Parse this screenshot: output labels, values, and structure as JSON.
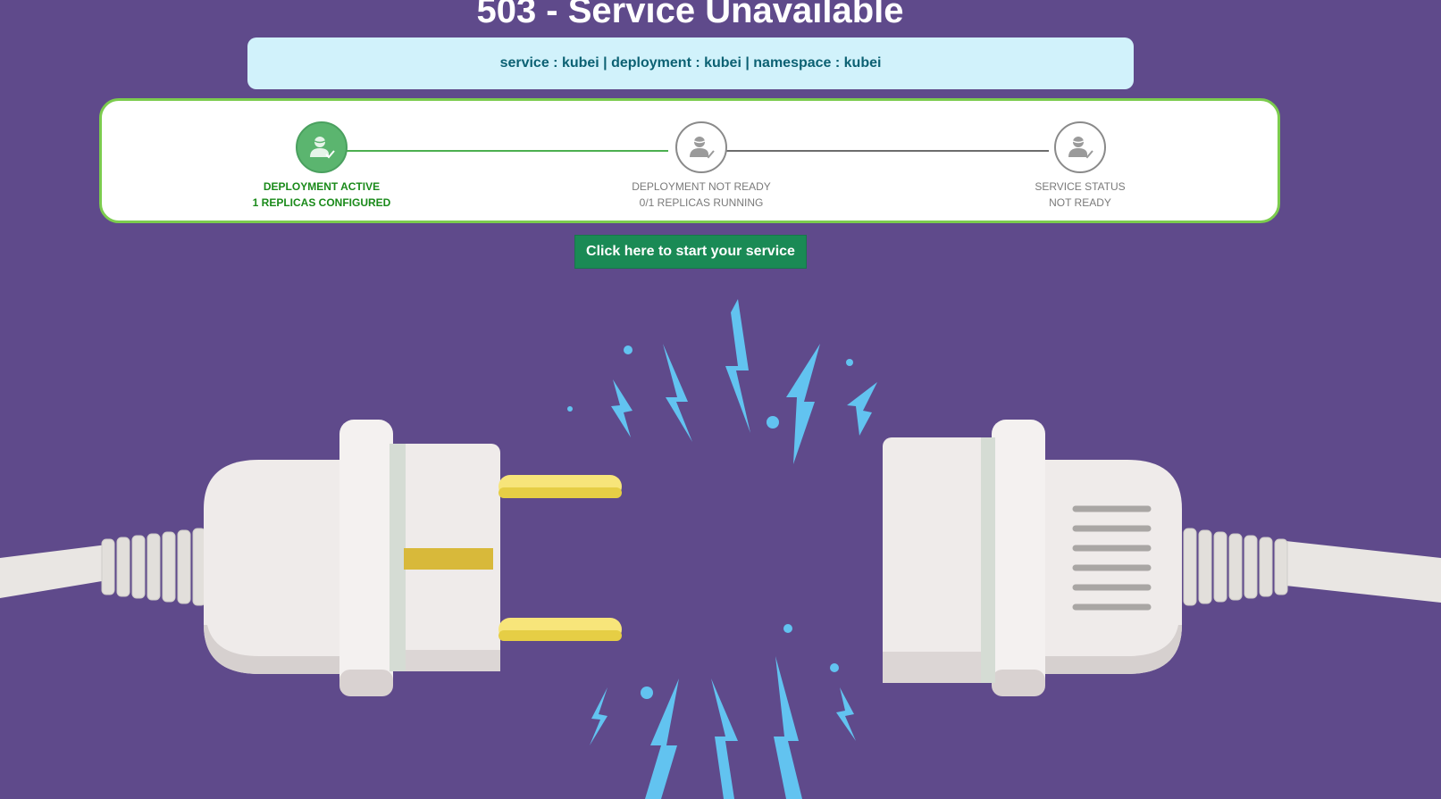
{
  "page": {
    "title": "503 - Service Unavailable"
  },
  "info_banner": {
    "text": "service : kubei | deployment : kubei | namespace : kubei"
  },
  "status_steps": [
    {
      "line1": "DEPLOYMENT ACTIVE",
      "line2": "1 REPLICAS CONFIGURED",
      "state": "active",
      "icon": "user-check-icon"
    },
    {
      "line1": "DEPLOYMENT NOT READY",
      "line2": "0/1 REPLICAS RUNNING",
      "state": "inactive",
      "icon": "user-check-icon"
    },
    {
      "line1": "SERVICE STATUS",
      "line2": "NOT READY",
      "state": "inactive",
      "icon": "user-check-icon"
    }
  ],
  "actions": {
    "start_label": "Click here to start your service"
  },
  "colors": {
    "background": "#5f4a8b",
    "banner": "#d1f2fb",
    "banner_text": "#0c6173",
    "active_green": "#5bb56f",
    "button": "#1a8a55",
    "card_border": "#7ccc4e",
    "spark": "#62c3f0"
  },
  "illustration": {
    "icon": "unplugged-cable-icon"
  }
}
